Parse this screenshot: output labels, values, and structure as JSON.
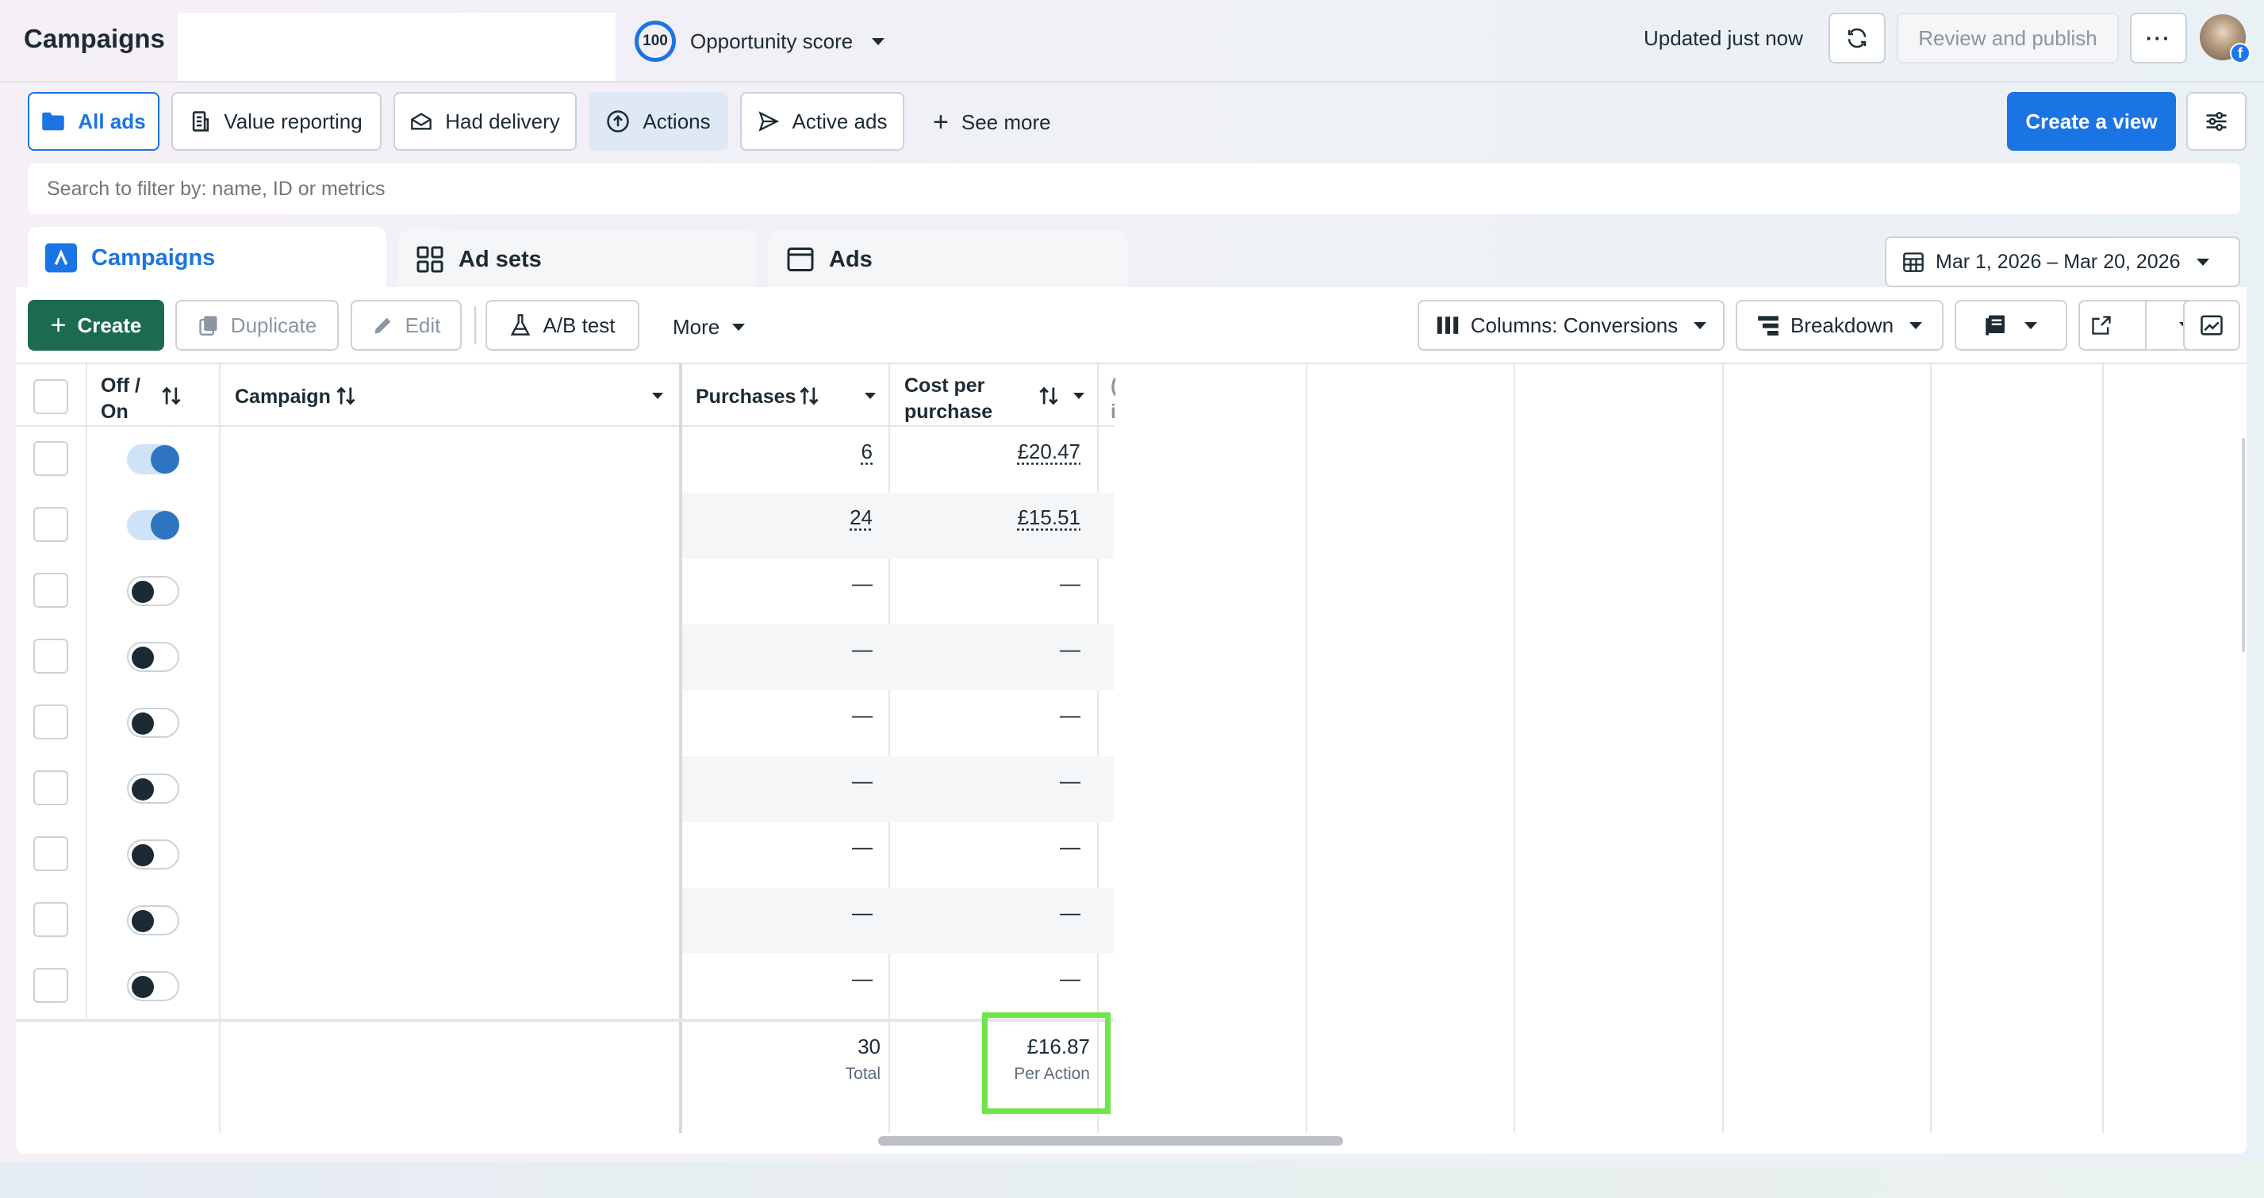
{
  "header": {
    "title": "Campaigns",
    "score_value": "100",
    "score_label": "Opportunity score",
    "updated": "Updated just now",
    "review_publish": "Review and publish"
  },
  "filters": {
    "all_ads": "All ads",
    "value_reporting": "Value reporting",
    "had_delivery": "Had delivery",
    "actions": "Actions",
    "active_ads": "Active ads",
    "see_more": "See more",
    "create_view": "Create a view"
  },
  "search": {
    "placeholder": "Search to filter by: name, ID or metrics"
  },
  "tabs": {
    "campaigns": "Campaigns",
    "ad_sets": "Ad sets",
    "ads": "Ads"
  },
  "date_range": "Mar 1, 2026 – Mar 20, 2026",
  "toolbar": {
    "create": "Create",
    "duplicate": "Duplicate",
    "edit": "Edit",
    "ab_test": "A/B test",
    "more": "More",
    "columns": "Columns: Conversions",
    "breakdown": "Breakdown"
  },
  "table": {
    "headers": {
      "off_on_1": "Off /",
      "off_on_2": "On",
      "campaign": "Campaign",
      "purchases": "Purchases",
      "cpp_1": "Cost per",
      "cpp_2": "purchase"
    },
    "rows": [
      {
        "on": true,
        "purchases": "6",
        "cost": "£20.47"
      },
      {
        "on": true,
        "purchases": "24",
        "cost": "£15.51"
      },
      {
        "on": false,
        "purchases": "—",
        "cost": "—"
      },
      {
        "on": false,
        "purchases": "—",
        "cost": "—"
      },
      {
        "on": false,
        "purchases": "—",
        "cost": "—"
      },
      {
        "on": false,
        "purchases": "—",
        "cost": "—"
      },
      {
        "on": false,
        "purchases": "—",
        "cost": "—"
      },
      {
        "on": false,
        "purchases": "—",
        "cost": "—"
      },
      {
        "on": false,
        "purchases": "—",
        "cost": "—"
      }
    ],
    "totals": {
      "purchases": "30",
      "purchases_label": "Total",
      "cost": "£16.87",
      "cost_label": "Per Action"
    }
  },
  "colors": {
    "accent": "#1b74e4",
    "create": "#1c6b4f",
    "highlight": "#6ee64a"
  }
}
